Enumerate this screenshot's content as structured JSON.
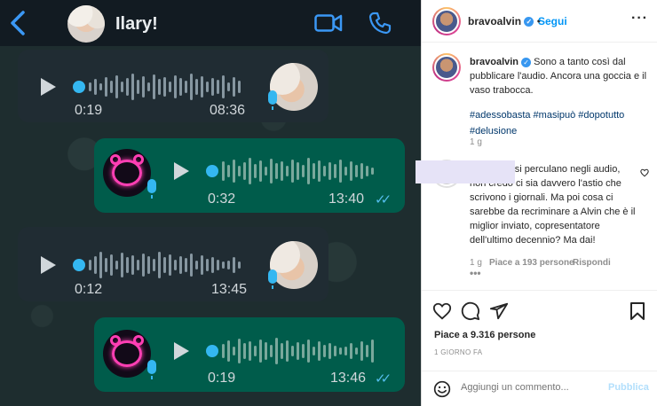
{
  "whatsapp": {
    "contact_name": "Ilary!",
    "messages": [
      {
        "direction": "in",
        "duration": "0:19",
        "time": "08:36"
      },
      {
        "direction": "out",
        "duration": "0:32",
        "time": "13:40"
      },
      {
        "direction": "in",
        "duration": "0:12",
        "time": "13:45"
      },
      {
        "direction": "out",
        "duration": "0:19",
        "time": "13:46"
      }
    ],
    "colors": {
      "accent": "#34b7f1",
      "incoming": "#202c33",
      "outgoing": "#005c4b",
      "read_ticks": "#53bdeb"
    }
  },
  "instagram": {
    "header": {
      "username": "bravoalvin",
      "follow_label": "Segui",
      "more_icon": "more-icon"
    },
    "caption": {
      "username": "bravoalvin",
      "text": "Sono a tanto così dal pubblicare l'audio. Ancora una goccia e il vaso trabocca.",
      "hashtags": "#adessobasta #masipuò #dopotutto #delusione",
      "time": "1 g"
    },
    "comment": {
      "text": "Ma sicuro si perculano negli audio, non credo ci sia davvero l'astio che scrivono i giornali. Ma poi cosa ci sarebbe da recriminare a Alvin che è il miglior inviato, copresentatore dell'ultimo decennio? Ma dai!",
      "time": "1 g",
      "likes": "Piace a 193 persone",
      "reply": "Rispondi",
      "more": "•••"
    },
    "likes": "Piace a 9.316 persone",
    "posted_ago": "1 GIORNO FA",
    "add_comment": {
      "placeholder": "Aggiungi un commento...",
      "publish_label": "Pubblica"
    },
    "colors": {
      "link": "#0095f6",
      "hashtag": "#00376b",
      "muted": "#8e8e8e"
    }
  }
}
